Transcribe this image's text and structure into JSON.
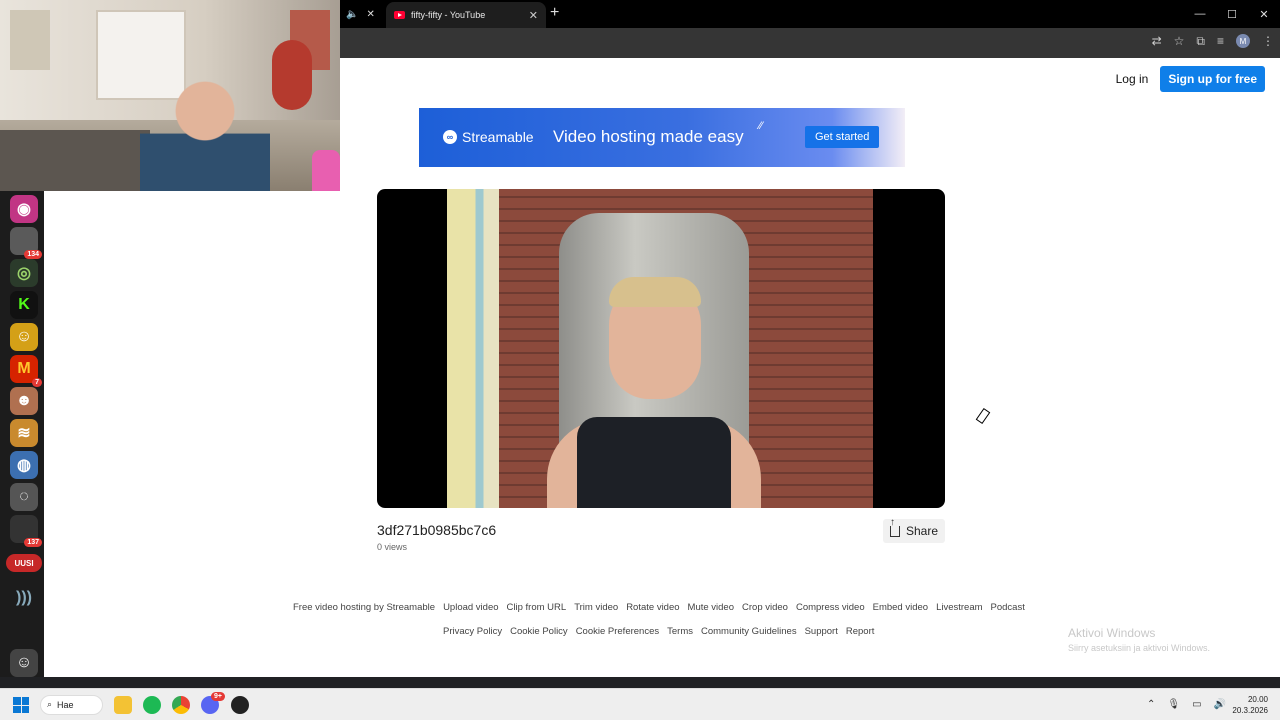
{
  "browser": {
    "tab_title": "fifty-fifty - YouTube",
    "tab_close": "✕",
    "newtab": "+",
    "audio_icon": "speaker-icon",
    "window_controls": [
      "—",
      "☐",
      "✕"
    ]
  },
  "header": {
    "login": "Log in",
    "signup": "Sign up for free"
  },
  "banner": {
    "brand": "Streamable",
    "tagline": "Video hosting made easy",
    "cta": "Get started"
  },
  "video": {
    "title": "3df271b0985bc7c6",
    "views": "0 views",
    "share": "Share"
  },
  "footer": {
    "row1": [
      "Free video hosting by Streamable",
      "Upload video",
      "Clip from URL",
      "Trim video",
      "Rotate video",
      "Mute video",
      "Crop video",
      "Compress video",
      "Embed video",
      "Livestream",
      "Podcast"
    ],
    "row2": [
      "Privacy Policy",
      "Cookie Policy",
      "Cookie Preferences",
      "Terms",
      "Community Guidelines",
      "Support",
      "Report"
    ]
  },
  "watermark": {
    "line1": "Aktivoi Windows",
    "line2": "Siirry asetuksiin ja aktivoi Windows."
  },
  "dock": {
    "badges": [
      "134",
      "7",
      "137"
    ],
    "uusi": "UUSI",
    "letter_k": "K",
    "letter_m": "M"
  },
  "taskbar": {
    "search": "Hae",
    "time": "20.00",
    "date": "20.3.2026",
    "discord_badge": "9+"
  },
  "colors": {
    "accent": "#0f7fe9",
    "banner": "#1d5fd8",
    "chrome_bg": "#202124"
  }
}
